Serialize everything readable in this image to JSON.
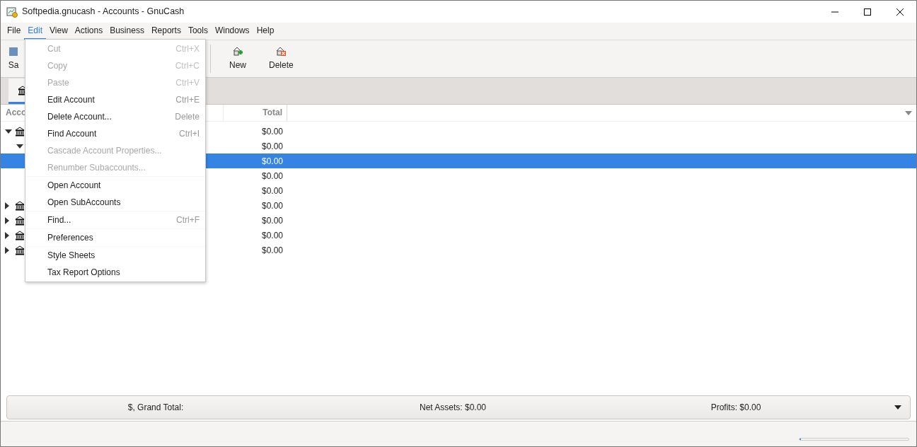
{
  "window": {
    "title": "Softpedia.gnucash - Accounts - GnuCash"
  },
  "menubar": [
    {
      "label": "File",
      "selected": false
    },
    {
      "label": "Edit",
      "selected": true
    },
    {
      "label": "View",
      "selected": false
    },
    {
      "label": "Actions",
      "selected": false
    },
    {
      "label": "Business",
      "selected": false
    },
    {
      "label": "Reports",
      "selected": false
    },
    {
      "label": "Tools",
      "selected": false
    },
    {
      "label": "Windows",
      "selected": false
    },
    {
      "label": "Help",
      "selected": false
    }
  ],
  "toolbar": [
    {
      "label": "Sa",
      "kind": "save"
    },
    {
      "label": "New",
      "kind": "new"
    },
    {
      "label": "Delete",
      "kind": "delete"
    }
  ],
  "table": {
    "columns": [
      {
        "label": "Acco"
      },
      {
        "label": "Total"
      }
    ],
    "rows": [
      {
        "total": "$0.00",
        "selected": false,
        "expanded": true,
        "children": [
          {
            "total": "$0.00",
            "selected": false,
            "expanded": true,
            "children": [
              {
                "total": "$0.00",
                "selected": true
              },
              {
                "total": "$0.00",
                "selected": false
              },
              {
                "total": "$0.00",
                "selected": false
              }
            ]
          }
        ]
      },
      {
        "total": "$0.00",
        "selected": false,
        "expanded": false
      },
      {
        "total": "$0.00",
        "selected": false,
        "expanded": false
      },
      {
        "total": "$0.00",
        "selected": false,
        "expanded": false
      },
      {
        "total": "$0.00",
        "selected": false,
        "expanded": false
      }
    ]
  },
  "status_bar": {
    "progress": {
      "level": 0
    }
  },
  "summary": {
    "grand_total": "$, Grand Total:",
    "net_assets": "Net Assets: $0.00",
    "profits": "Profits: $0.00"
  },
  "edit_menu": [
    {
      "label": "Cut",
      "shortcut": "Ctrl+X",
      "disabled": true,
      "separator_after": false
    },
    {
      "label": "Copy",
      "shortcut": "Ctrl+C",
      "disabled": true,
      "separator_after": false
    },
    {
      "label": "Paste",
      "shortcut": "Ctrl+V",
      "disabled": true,
      "separator_after": false
    },
    {
      "label": "Edit Account",
      "shortcut": "Ctrl+E",
      "disabled": false,
      "separator_after": false
    },
    {
      "label": "Delete Account...",
      "shortcut": "Delete",
      "disabled": false,
      "separator_after": false
    },
    {
      "label": "Find Account",
      "shortcut": "Ctrl+I",
      "disabled": false,
      "separator_after": false
    },
    {
      "label": "Cascade Account Properties...",
      "disabled": true,
      "separator_after": false
    },
    {
      "label": "Renumber Subaccounts...",
      "disabled": true,
      "separator_after": true
    },
    {
      "label": "Open Account",
      "disabled": false,
      "separator_after": false
    },
    {
      "label": "Open SubAccounts",
      "disabled": false,
      "separator_after": true
    },
    {
      "label": "Find...",
      "shortcut": "Ctrl+F",
      "disabled": false,
      "separator_after": true
    },
    {
      "label": "Preferences",
      "disabled": false,
      "separator_after": true
    },
    {
      "label": "Style Sheets",
      "disabled": false,
      "separator_after": false
    },
    {
      "label": "Tax Report Options",
      "disabled": false,
      "separator_after": false
    }
  ]
}
